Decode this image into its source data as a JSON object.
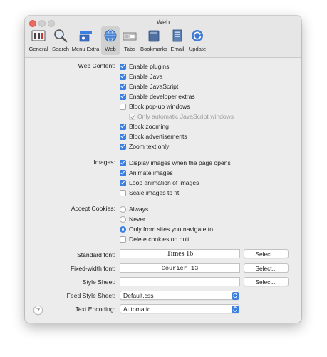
{
  "window": {
    "title": "Web"
  },
  "toolbar": [
    {
      "label": "General",
      "icon": "general-icon"
    },
    {
      "label": "Search",
      "icon": "magnifier-icon"
    },
    {
      "label": "Menu Extra",
      "icon": "menu-extra-icon"
    },
    {
      "label": "Web",
      "icon": "globe-icon",
      "selected": true
    },
    {
      "label": "Tabs",
      "icon": "tabs-icon"
    },
    {
      "label": "Bookmarks",
      "icon": "bookmarks-icon"
    },
    {
      "label": "Email",
      "icon": "email-icon"
    },
    {
      "label": "Update",
      "icon": "update-icon"
    }
  ],
  "web_content": {
    "label": "Web Content:",
    "options": [
      {
        "label": "Enable plugins",
        "checked": true
      },
      {
        "label": "Enable Java",
        "checked": true
      },
      {
        "label": "Enable JavaScript",
        "checked": true
      },
      {
        "label": "Enable developer extras",
        "checked": true
      },
      {
        "label": "Block pop-up windows",
        "checked": false
      },
      {
        "label": "Only automatic JavaScript windows",
        "checked": true,
        "disabled": true
      },
      {
        "label": "Block zooming",
        "checked": true
      },
      {
        "label": "Block advertisements",
        "checked": true
      },
      {
        "label": "Zoom text only",
        "checked": true
      }
    ]
  },
  "images": {
    "label": "Images:",
    "options": [
      {
        "label": "Display images when the page opens",
        "checked": true
      },
      {
        "label": "Animate images",
        "checked": true
      },
      {
        "label": "Loop animation of images",
        "checked": true
      },
      {
        "label": "Scale images to fit",
        "checked": false
      }
    ]
  },
  "cookies": {
    "label": "Accept Cookies:",
    "options": [
      {
        "label": "Always",
        "selected": false
      },
      {
        "label": "Never",
        "selected": false
      },
      {
        "label": "Only from sites you navigate to",
        "selected": true
      }
    ],
    "delete_label": "Delete cookies on quit",
    "delete_checked": false
  },
  "fonts": {
    "standard_label": "Standard font:",
    "standard_value": "Times 16",
    "fixed_label": "Fixed-width font:",
    "fixed_value": "Courier 13",
    "stylesheet_label": "Style Sheet:",
    "stylesheet_value": "",
    "select_label": "Select..."
  },
  "feed_style_sheet": {
    "label": "Feed Style Sheet:",
    "value": "Default.css"
  },
  "text_encoding": {
    "label": "Text Encoding:",
    "value": "Automatic"
  },
  "help_label": "?",
  "colors": {
    "accent": "#3b7fe0",
    "close": "#ee6a5f",
    "window_bg": "#ececec"
  }
}
